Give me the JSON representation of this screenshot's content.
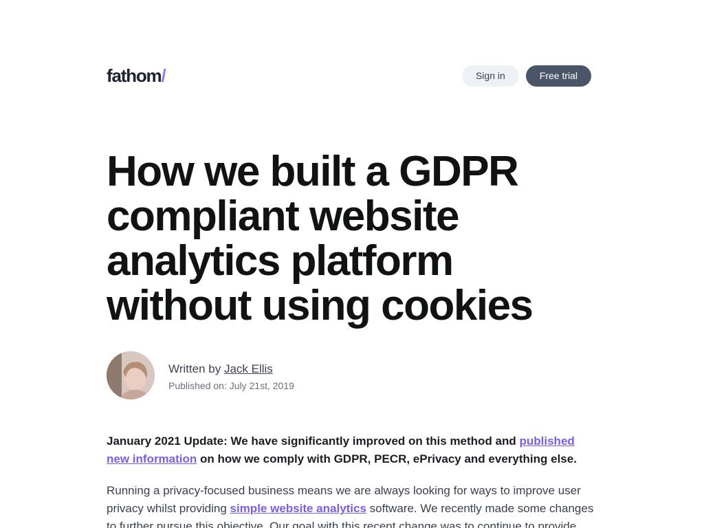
{
  "header": {
    "logo_text": "fathom",
    "logo_slash": "/",
    "signin_label": "Sign in",
    "trial_label": "Free trial"
  },
  "article": {
    "title": "How we built a GDPR compliant website analytics platform without using cookies",
    "author": {
      "written_by": "Written by ",
      "name": "Jack Ellis",
      "published": "Published on: July 21st, 2019"
    },
    "update": {
      "lead": "January 2021 Update: We have significantly improved on this method and ",
      "link": "published new information",
      "tail": " on how we comply with GDPR, PECR, ePrivacy and everything else."
    },
    "intro": {
      "lead": "Running a privacy-focused business means we are always looking for ways to improve user privacy whilst providing ",
      "link": "simple website analytics",
      "tail": " software. We recently made some changes to further pursue this objective. Our goal with this recent change was to continue to provide"
    }
  },
  "colors": {
    "accent": "#7a5cf0",
    "button_dark": "#4b5568",
    "button_light": "#eef1f5"
  }
}
